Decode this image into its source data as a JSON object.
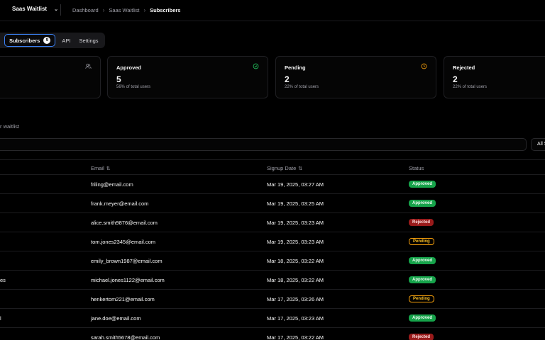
{
  "topbar": {
    "project": "Saas Waitlist",
    "breadcrumb": [
      "Dashboard",
      "Saas Waitlist",
      "Subscribers"
    ]
  },
  "tabs": {
    "subscribers_label": "Subscribers",
    "subscribers_count": "9",
    "api_label": "API",
    "settings_label": "Settings"
  },
  "cards": {
    "approved": {
      "label": "Approved",
      "value": "5",
      "sub": "56% of total users"
    },
    "pending": {
      "label": "Pending",
      "value": "2",
      "sub": "22% of total users"
    },
    "rejected": {
      "label": "Rejected",
      "value": "2",
      "sub": "22% of total users"
    }
  },
  "desc": "r waitlist",
  "filter_label": "All S",
  "colors": {
    "approved": "#16a34a",
    "rejected": "#991b1b",
    "pending": "#f59e0b",
    "accent": "#3b82f6"
  },
  "table": {
    "headers": {
      "email": "Email",
      "signup": "Signup Date",
      "status": "Status"
    },
    "rows": [
      {
        "name": "",
        "email": "friling@email.com",
        "date": "Mar 19, 2025, 03:27 AM",
        "status": "Approved"
      },
      {
        "name": "",
        "email": "frank.meyer@email.com",
        "date": "Mar 19, 2025, 03:25 AM",
        "status": "Approved"
      },
      {
        "name": "",
        "email": "alice.smith9876@email.com",
        "date": "Mar 19, 2025, 03:23 AM",
        "status": "Rejected"
      },
      {
        "name": "",
        "email": "tom.jones2345@email.com",
        "date": "Mar 19, 2025, 03:23 AM",
        "status": "Pending"
      },
      {
        "name": "",
        "email": "emily_brown1987@email.com",
        "date": "Mar 18, 2025, 03:22 AM",
        "status": "Approved"
      },
      {
        "name": "es",
        "email": "michael.jones1122@email.com",
        "date": "Mar 18, 2025, 03:22 AM",
        "status": "Approved"
      },
      {
        "name": "",
        "email": "henkertom221@email.com",
        "date": "Mar 17, 2025, 03:26 AM",
        "status": "Pending"
      },
      {
        "name": "l",
        "email": "jane.doe@email.com",
        "date": "Mar 17, 2025, 03:23 AM",
        "status": "Approved"
      },
      {
        "name": "",
        "email": "sarah.smith5678@email.com",
        "date": "Mar 17, 2025, 03:22 AM",
        "status": "Rejected"
      }
    ]
  }
}
